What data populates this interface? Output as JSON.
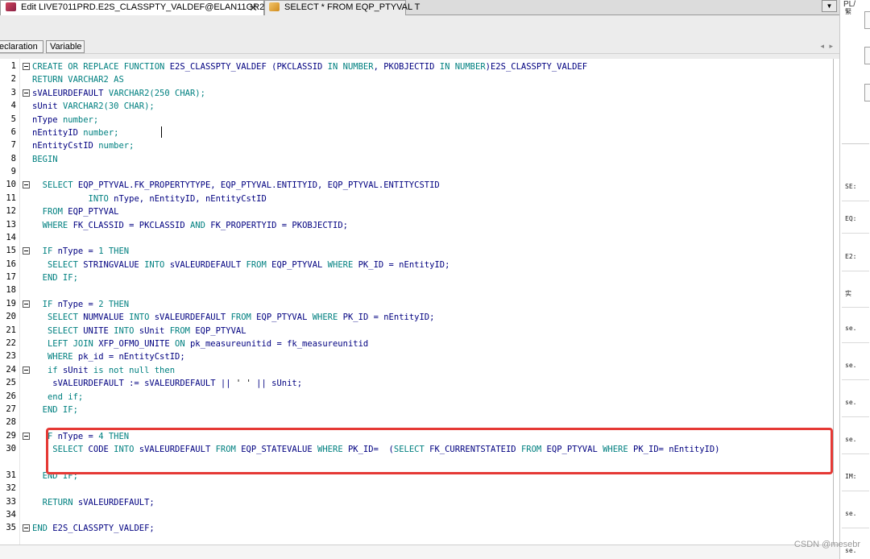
{
  "tabs": [
    {
      "label": "Edit LIVE7011PRD.E2S_CLASSPTY_VALDEF@ELAN11GR2",
      "close": "✕"
    },
    {
      "label": "SELECT * FROM EQP_PTYVAL T"
    }
  ],
  "tab_dropdown": "▼",
  "subtabs": [
    "eclaration",
    "Variable"
  ],
  "scroll_arrows": "◂ ▸",
  "right_panel": {
    "title": "PL/",
    "rows": [
      "緊",
      "SE:",
      "EQ:",
      "E2:",
      "实",
      "se.",
      "se.",
      "se.",
      "se.",
      "IM:",
      "se.",
      "se."
    ]
  },
  "code_lines": [
    {
      "n": "1",
      "fold": true,
      "tokens": [
        [
          "CREATE OR REPLACE FUNCTION ",
          "kw"
        ],
        [
          "E2S_CLASSPTY_VALDEF (PKCLASSID ",
          "id"
        ],
        [
          "IN NUMBER",
          "kw"
        ],
        [
          ", PKOBJECTID ",
          "id"
        ],
        [
          "IN NUMBER",
          "kw"
        ],
        [
          ")E2S_CLASSPTY_VALDEF",
          "id"
        ]
      ]
    },
    {
      "n": "2",
      "fold": false,
      "tokens": [
        [
          "RETURN VARCHAR2 AS",
          "kw"
        ]
      ]
    },
    {
      "n": "3",
      "fold": true,
      "tokens": [
        [
          "sVALEURDEFAULT ",
          "id"
        ],
        [
          "VARCHAR2(250 CHAR);",
          "kw"
        ]
      ]
    },
    {
      "n": "4",
      "fold": false,
      "tokens": [
        [
          "sUnit ",
          "id"
        ],
        [
          "VARCHAR2(30 CHAR);",
          "kw"
        ]
      ]
    },
    {
      "n": "5",
      "fold": false,
      "tokens": [
        [
          "nType ",
          "id"
        ],
        [
          "number;",
          "kw"
        ]
      ]
    },
    {
      "n": "6",
      "fold": false,
      "tokens": [
        [
          "nEntityID ",
          "id"
        ],
        [
          "number;",
          "kw"
        ]
      ]
    },
    {
      "n": "7",
      "fold": false,
      "tokens": [
        [
          "nEntityCstID ",
          "id"
        ],
        [
          "number;",
          "kw"
        ]
      ]
    },
    {
      "n": "8",
      "fold": false,
      "tokens": [
        [
          "BEGIN",
          "kw"
        ]
      ]
    },
    {
      "n": "9",
      "fold": false,
      "tokens": []
    },
    {
      "n": "10",
      "fold": true,
      "tokens": [
        [
          "  SELECT ",
          "kw"
        ],
        [
          "EQP_PTYVAL.FK_PROPERTYTYPE, EQP_PTYVAL.ENTITYID, EQP_PTYVAL.ENTITYCSTID",
          "id"
        ]
      ]
    },
    {
      "n": "11",
      "fold": false,
      "tokens": [
        [
          "           INTO ",
          "kw"
        ],
        [
          "nType, nEntityID, nEntityCstID",
          "id"
        ]
      ]
    },
    {
      "n": "12",
      "fold": false,
      "tokens": [
        [
          "  FROM ",
          "kw"
        ],
        [
          "EQP_PTYVAL",
          "id"
        ]
      ]
    },
    {
      "n": "13",
      "fold": false,
      "tokens": [
        [
          "  WHERE ",
          "kw"
        ],
        [
          "FK_CLASSID = PKCLASSID ",
          "id"
        ],
        [
          "AND ",
          "kw"
        ],
        [
          "FK_PROPERTYID = PKOBJECTID;",
          "id"
        ]
      ]
    },
    {
      "n": "14",
      "fold": false,
      "tokens": []
    },
    {
      "n": "15",
      "fold": true,
      "tokens": [
        [
          "  IF ",
          "kw"
        ],
        [
          "nType = ",
          "id"
        ],
        [
          "1 THEN",
          "kw"
        ]
      ]
    },
    {
      "n": "16",
      "fold": false,
      "tokens": [
        [
          "   SELECT ",
          "kw"
        ],
        [
          "STRINGVALUE ",
          "id"
        ],
        [
          "INTO ",
          "kw"
        ],
        [
          "sVALEURDEFAULT ",
          "id"
        ],
        [
          "FROM ",
          "kw"
        ],
        [
          "EQP_PTYVAL ",
          "id"
        ],
        [
          "WHERE ",
          "kw"
        ],
        [
          "PK_ID = nEntityID;",
          "id"
        ]
      ]
    },
    {
      "n": "17",
      "fold": false,
      "tokens": [
        [
          "  END IF;",
          "kw"
        ]
      ]
    },
    {
      "n": "18",
      "fold": false,
      "tokens": []
    },
    {
      "n": "19",
      "fold": true,
      "tokens": [
        [
          "  IF ",
          "kw"
        ],
        [
          "nType = ",
          "id"
        ],
        [
          "2 THEN",
          "kw"
        ]
      ]
    },
    {
      "n": "20",
      "fold": false,
      "tokens": [
        [
          "   SELECT ",
          "kw"
        ],
        [
          "NUMVALUE ",
          "id"
        ],
        [
          "INTO ",
          "kw"
        ],
        [
          "sVALEURDEFAULT ",
          "id"
        ],
        [
          "FROM ",
          "kw"
        ],
        [
          "EQP_PTYVAL ",
          "id"
        ],
        [
          "WHERE ",
          "kw"
        ],
        [
          "PK_ID = nEntityID;",
          "id"
        ]
      ]
    },
    {
      "n": "21",
      "fold": false,
      "tokens": [
        [
          "   SELECT ",
          "kw"
        ],
        [
          "UNITE ",
          "id"
        ],
        [
          "INTO ",
          "kw"
        ],
        [
          "sUnit ",
          "id"
        ],
        [
          "FROM ",
          "kw"
        ],
        [
          "EQP_PTYVAL",
          "id"
        ]
      ]
    },
    {
      "n": "22",
      "fold": false,
      "tokens": [
        [
          "   LEFT JOIN ",
          "kw"
        ],
        [
          "XFP_OFMO_UNITE ",
          "id"
        ],
        [
          "ON ",
          "kw"
        ],
        [
          "pk_measureunitid = fk_measureunitid",
          "id"
        ]
      ]
    },
    {
      "n": "23",
      "fold": false,
      "tokens": [
        [
          "   WHERE ",
          "kw"
        ],
        [
          "pk_id = nEntityCstID;",
          "id"
        ]
      ]
    },
    {
      "n": "24",
      "fold": true,
      "tokens": [
        [
          "   if ",
          "kw"
        ],
        [
          "sUnit ",
          "id"
        ],
        [
          "is not null then",
          "kw"
        ]
      ]
    },
    {
      "n": "25",
      "fold": false,
      "tokens": [
        [
          "    sVALEURDEFAULT := sVALEURDEFAULT || ",
          "id"
        ],
        [
          "' '",
          "plain"
        ],
        [
          " || sUnit;",
          "id"
        ]
      ]
    },
    {
      "n": "26",
      "fold": false,
      "tokens": [
        [
          "   end if;",
          "kw"
        ]
      ]
    },
    {
      "n": "27",
      "fold": false,
      "tokens": [
        [
          "  END IF;",
          "kw"
        ]
      ]
    },
    {
      "n": "28",
      "fold": false,
      "tokens": []
    },
    {
      "n": "29",
      "fold": true,
      "tokens": [
        [
          "   F ",
          "kw"
        ],
        [
          "nType = ",
          "id"
        ],
        [
          "4 THEN",
          "kw"
        ]
      ]
    },
    {
      "n": "30",
      "fold": false,
      "tokens": [
        [
          "    SELECT ",
          "kw"
        ],
        [
          "CODE ",
          "id"
        ],
        [
          "INTO ",
          "kw"
        ],
        [
          "sVALEURDEFAULT ",
          "id"
        ],
        [
          "FROM ",
          "kw"
        ],
        [
          "EQP_STATEVALUE ",
          "id"
        ],
        [
          "WHERE ",
          "kw"
        ],
        [
          "PK_ID=  (",
          "id"
        ],
        [
          "SELECT ",
          "kw"
        ],
        [
          "FK_CURRENTSTATEID ",
          "id"
        ],
        [
          "FROM ",
          "kw"
        ],
        [
          "EQP_PTYVAL ",
          "id"
        ],
        [
          "WHERE ",
          "kw"
        ],
        [
          "PK_ID= nEntityID)",
          "id"
        ]
      ]
    },
    {
      "n": "",
      "fold": false,
      "tokens": [
        [
          ";",
          "plain"
        ]
      ]
    },
    {
      "n": "31",
      "fold": false,
      "tokens": [
        [
          "  END IF;",
          "kw"
        ]
      ]
    },
    {
      "n": "32",
      "fold": false,
      "tokens": []
    },
    {
      "n": "33",
      "fold": false,
      "tokens": [
        [
          "  RETURN ",
          "kw"
        ],
        [
          "sVALEURDEFAULT;",
          "id"
        ]
      ]
    },
    {
      "n": "34",
      "fold": false,
      "tokens": []
    },
    {
      "n": "35",
      "fold": true,
      "tokens": [
        [
          "END ",
          "kw"
        ],
        [
          "E2S_CLASSPTY_VALDEF;",
          "id"
        ]
      ]
    }
  ],
  "watermark": "CSDN @mesebr",
  "colors": {
    "keyword": "#008080",
    "identifier": "#000080",
    "highlight": "#e53935"
  }
}
